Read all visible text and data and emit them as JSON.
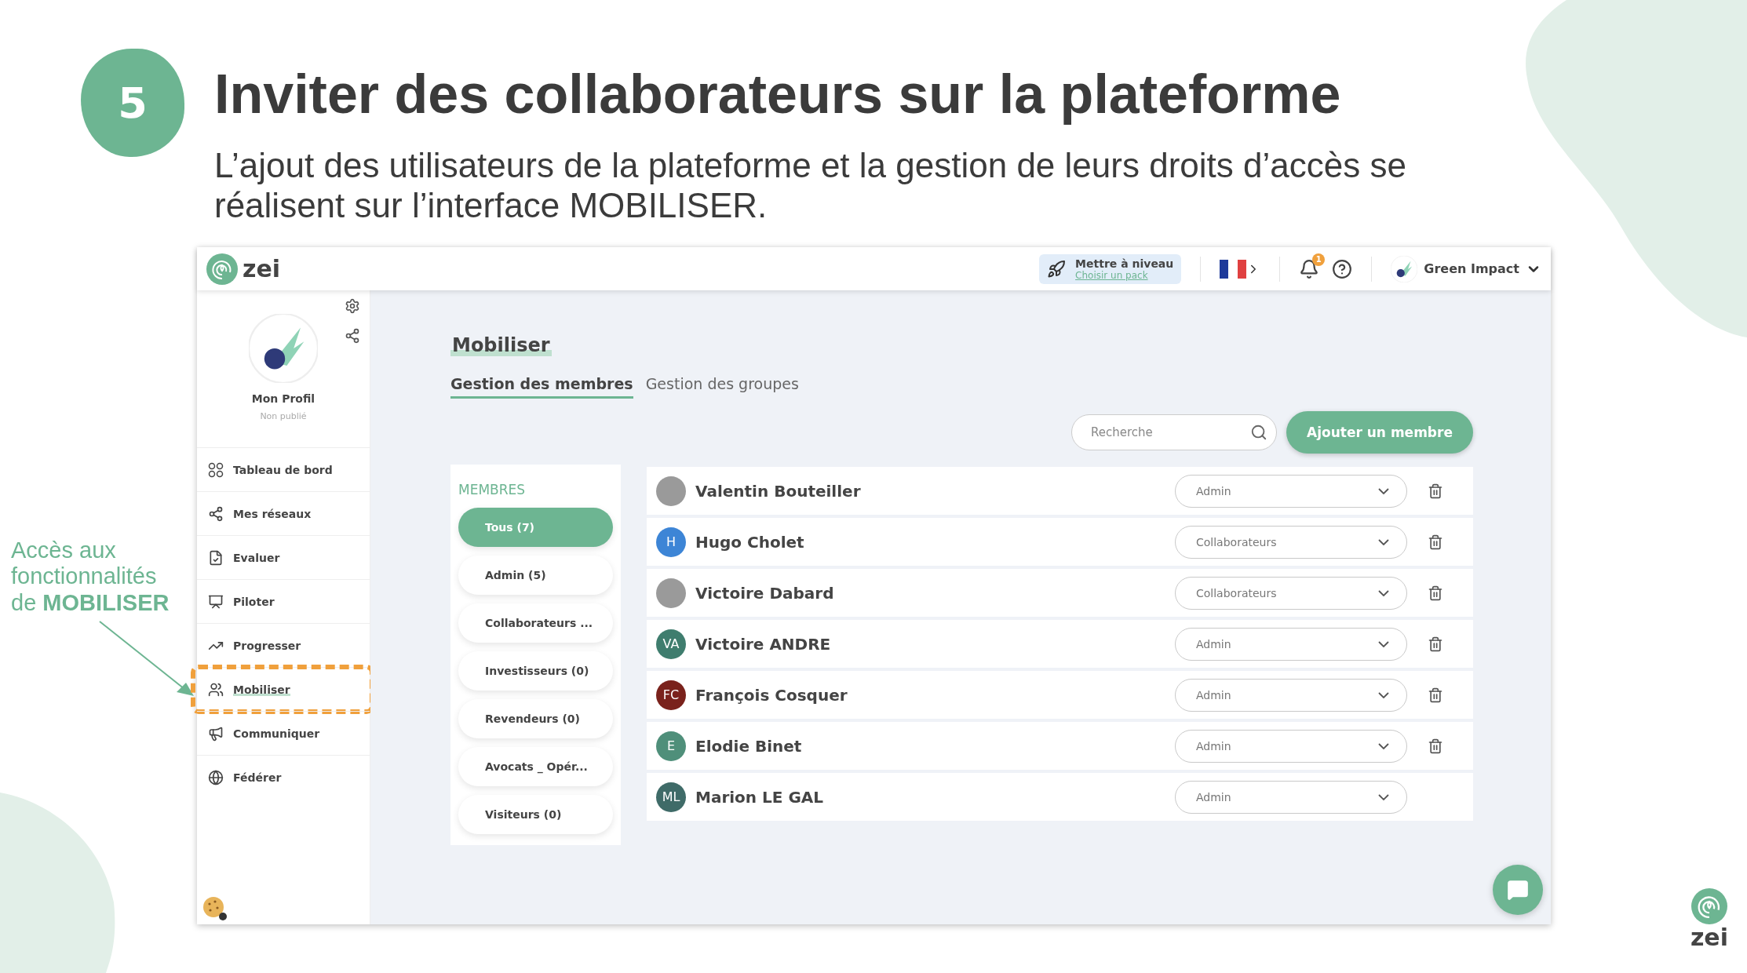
{
  "slide": {
    "step": "5",
    "title": "Inviter des collaborateurs sur la plateforme",
    "subtitle": "L’ajout des utilisateurs de la plateforme et la gestion de leurs droits d’accès se réalisent sur l’interface MOBILISER.",
    "annotation": "Accès aux fonctionnalités de **MOBILISER**",
    "footer_logo": "zei"
  },
  "app": {
    "logo": "zei",
    "upgrade": {
      "title": "Mettre à niveau",
      "link": "Choisir un pack"
    },
    "notifications": "1",
    "account": "Green Impact",
    "profile": {
      "name": "Mon Profil",
      "status": "Non publié"
    },
    "nav": [
      {
        "label": "Tableau de bord",
        "selected": false,
        "highlighted": false
      },
      {
        "label": "Mes réseaux",
        "selected": false,
        "highlighted": false
      },
      {
        "label": "Evaluer",
        "selected": false,
        "highlighted": false
      },
      {
        "label": "Piloter",
        "selected": false,
        "highlighted": false
      },
      {
        "label": "Progresser",
        "selected": false,
        "highlighted": false
      },
      {
        "label": "Mobiliser",
        "selected": true,
        "highlighted": true
      },
      {
        "label": "Communiquer",
        "selected": false,
        "highlighted": false
      },
      {
        "label": "Fédérer",
        "selected": false,
        "highlighted": false
      }
    ],
    "page_title": "Mobiliser",
    "tabs": [
      {
        "label": "Gestion des membres",
        "selected": true
      },
      {
        "label": "Gestion des groupes",
        "selected": false
      }
    ],
    "search": {
      "placeholder": "Recherche"
    },
    "add_button": "Ajouter un membre",
    "groups": {
      "title": "MEMBRES",
      "items": [
        {
          "label": "Tous (7)",
          "selected": true
        },
        {
          "label": "Admin (5)",
          "selected": false
        },
        {
          "label": "Collaborateurs ...",
          "selected": false
        },
        {
          "label": "Investisseurs (0)",
          "selected": false
        },
        {
          "label": "Revendeurs (0)",
          "selected": false
        },
        {
          "label": "Avocats _ Opér...",
          "selected": false
        },
        {
          "label": "Visiteurs (0)",
          "selected": false
        }
      ]
    },
    "members": [
      {
        "name": "Valentin Bouteiller",
        "avatar": {
          "kind": "photo"
        },
        "role": "Admin",
        "deletable": true
      },
      {
        "name": "Hugo Cholet",
        "avatar": {
          "kind": "initials",
          "initials": "H",
          "color": "#3d85d6"
        },
        "role": "Collaborateurs",
        "deletable": true
      },
      {
        "name": "Victoire Dabard",
        "avatar": {
          "kind": "photo"
        },
        "role": "Collaborateurs",
        "deletable": true
      },
      {
        "name": "Victoire ANDRE",
        "avatar": {
          "kind": "initials",
          "initials": "VA",
          "color": "#3f7d6e"
        },
        "role": "Admin",
        "deletable": true
      },
      {
        "name": "François Cosquer",
        "avatar": {
          "kind": "initials",
          "initials": "FC",
          "color": "#7a221c"
        },
        "role": "Admin",
        "deletable": true
      },
      {
        "name": "Elodie Binet",
        "avatar": {
          "kind": "initials",
          "initials": "E",
          "color": "#4f8f7a"
        },
        "role": "Admin",
        "deletable": true
      },
      {
        "name": "Marion LE GAL",
        "avatar": {
          "kind": "initials",
          "initials": "ML",
          "color": "#3f6b68"
        },
        "role": "Admin",
        "deletable": false
      }
    ]
  }
}
